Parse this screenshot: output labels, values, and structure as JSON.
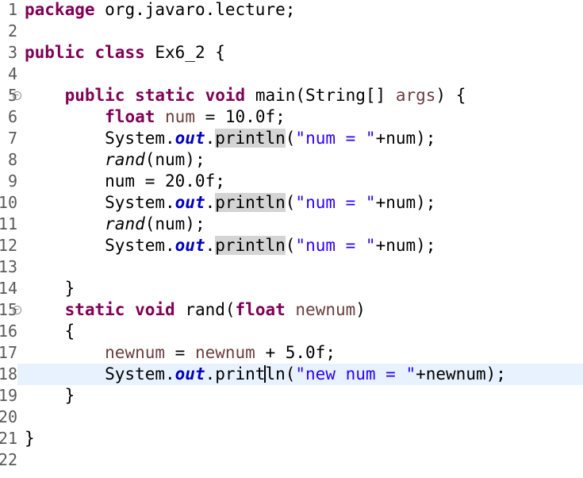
{
  "editor": {
    "current_line": 18,
    "lines": [
      {
        "num": "1",
        "tokens": [
          {
            "t": "package",
            "c": "kw"
          },
          {
            "t": " org.javaro.lecture;"
          }
        ]
      },
      {
        "num": "2",
        "tokens": []
      },
      {
        "num": "3",
        "tokens": [
          {
            "t": "public",
            "c": "kw"
          },
          {
            "t": " "
          },
          {
            "t": "class",
            "c": "kw"
          },
          {
            "t": " Ex6_2 {"
          }
        ]
      },
      {
        "num": "4",
        "tokens": []
      },
      {
        "num": "5",
        "fold": true,
        "tokens": [
          {
            "t": "    "
          },
          {
            "t": "public",
            "c": "kw"
          },
          {
            "t": " "
          },
          {
            "t": "static",
            "c": "kw"
          },
          {
            "t": " "
          },
          {
            "t": "void",
            "c": "kw"
          },
          {
            "t": " main(String[] "
          },
          {
            "t": "args",
            "c": "var"
          },
          {
            "t": ") {"
          }
        ]
      },
      {
        "num": "6",
        "tokens": [
          {
            "t": "        "
          },
          {
            "t": "float",
            "c": "kw"
          },
          {
            "t": " "
          },
          {
            "t": "num",
            "c": "var"
          },
          {
            "t": " = 10.0f;"
          }
        ]
      },
      {
        "num": "7",
        "tokens": [
          {
            "t": "        System."
          },
          {
            "t": "out",
            "c": "fld"
          },
          {
            "t": "."
          },
          {
            "t": "println",
            "c": "mark"
          },
          {
            "t": "("
          },
          {
            "t": "\"num = \"",
            "c": "str"
          },
          {
            "t": "+num);"
          }
        ]
      },
      {
        "num": "8",
        "tokens": [
          {
            "t": "        "
          },
          {
            "t": "rand",
            "c": "smeth"
          },
          {
            "t": "(num);"
          }
        ]
      },
      {
        "num": "9",
        "tokens": [
          {
            "t": "        num = 20.0f;"
          }
        ]
      },
      {
        "num": "10",
        "tokens": [
          {
            "t": "        System."
          },
          {
            "t": "out",
            "c": "fld"
          },
          {
            "t": "."
          },
          {
            "t": "println",
            "c": "mark"
          },
          {
            "t": "("
          },
          {
            "t": "\"num = \"",
            "c": "str"
          },
          {
            "t": "+num);"
          }
        ]
      },
      {
        "num": "11",
        "tokens": [
          {
            "t": "        "
          },
          {
            "t": "rand",
            "c": "smeth"
          },
          {
            "t": "(num);"
          }
        ]
      },
      {
        "num": "12",
        "tokens": [
          {
            "t": "        System."
          },
          {
            "t": "out",
            "c": "fld"
          },
          {
            "t": "."
          },
          {
            "t": "println",
            "c": "mark"
          },
          {
            "t": "("
          },
          {
            "t": "\"num = \"",
            "c": "str"
          },
          {
            "t": "+num);"
          }
        ]
      },
      {
        "num": "13",
        "tokens": []
      },
      {
        "num": "14",
        "tokens": [
          {
            "t": "    }"
          }
        ]
      },
      {
        "num": "15",
        "fold": true,
        "tokens": [
          {
            "t": "    "
          },
          {
            "t": "static",
            "c": "kw"
          },
          {
            "t": " "
          },
          {
            "t": "void",
            "c": "kw"
          },
          {
            "t": " rand("
          },
          {
            "t": "float",
            "c": "kw"
          },
          {
            "t": " "
          },
          {
            "t": "newnum",
            "c": "var"
          },
          {
            "t": ")"
          }
        ]
      },
      {
        "num": "16",
        "tokens": [
          {
            "t": "    {"
          }
        ]
      },
      {
        "num": "17",
        "tokens": [
          {
            "t": "        "
          },
          {
            "t": "newnum",
            "c": "var"
          },
          {
            "t": " = "
          },
          {
            "t": "newnum",
            "c": "var"
          },
          {
            "t": " + 5.0f;"
          }
        ]
      },
      {
        "num": "18",
        "tokens": [
          {
            "t": "        System."
          },
          {
            "t": "out",
            "c": "fld"
          },
          {
            "t": ".print"
          },
          {
            "t": "|",
            "c": "caret"
          },
          {
            "t": "ln("
          },
          {
            "t": "\"new num = \"",
            "c": "str"
          },
          {
            "t": "+newnum);"
          }
        ]
      },
      {
        "num": "19",
        "tokens": [
          {
            "t": "    }"
          }
        ]
      },
      {
        "num": "20",
        "tokens": []
      },
      {
        "num": "21",
        "tokens": [
          {
            "t": "}"
          }
        ]
      },
      {
        "num": "22",
        "tokens": []
      }
    ]
  }
}
